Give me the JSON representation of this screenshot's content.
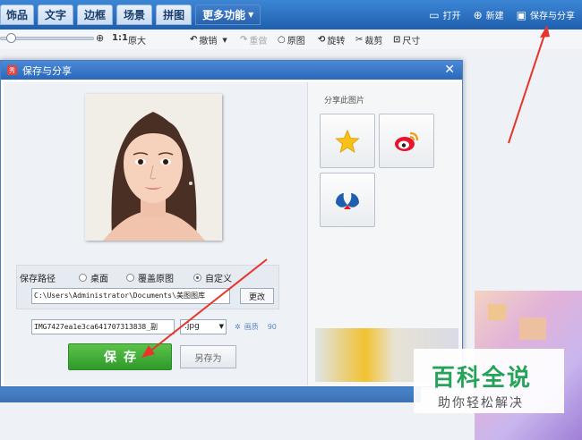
{
  "top_tabs": [
    "饰品",
    "文字",
    "边框",
    "场景",
    "拼图",
    "更多功能"
  ],
  "top_right": {
    "open": "打开",
    "new": "新建",
    "save_share": "保存与分享"
  },
  "toolbar": {
    "ratio": "1:1",
    "original_size": "原大",
    "undo": "撤销",
    "redo": "重做",
    "original": "原图",
    "rotate": "旋转",
    "crop": "裁剪",
    "size": "尺寸"
  },
  "dialog": {
    "title": "保存与分享",
    "save_path_label": "保存路径",
    "radio_options": [
      {
        "label": "桌面",
        "selected": false
      },
      {
        "label": "覆盖原图",
        "selected": false
      },
      {
        "label": "自定义",
        "selected": true
      }
    ],
    "path_value": "C:\\Users\\Administrator\\Documents\\美图图库",
    "change_button": "更改",
    "filename_value": "IMG7427ea1e3ca641707313838_副",
    "extension": ".jpg",
    "quality_label": "画质",
    "quality_value": "90",
    "save_button": "保存",
    "save_as_button": "另存为",
    "share_label": "分享此图片"
  },
  "watermark": {
    "title": "百科全说",
    "subtitle": "助你轻松解决"
  },
  "colors": {
    "accent": "#2b67b8",
    "save_green": "#3aa833",
    "arrow_red": "#e8352a",
    "watermark_green": "#26a35a"
  }
}
